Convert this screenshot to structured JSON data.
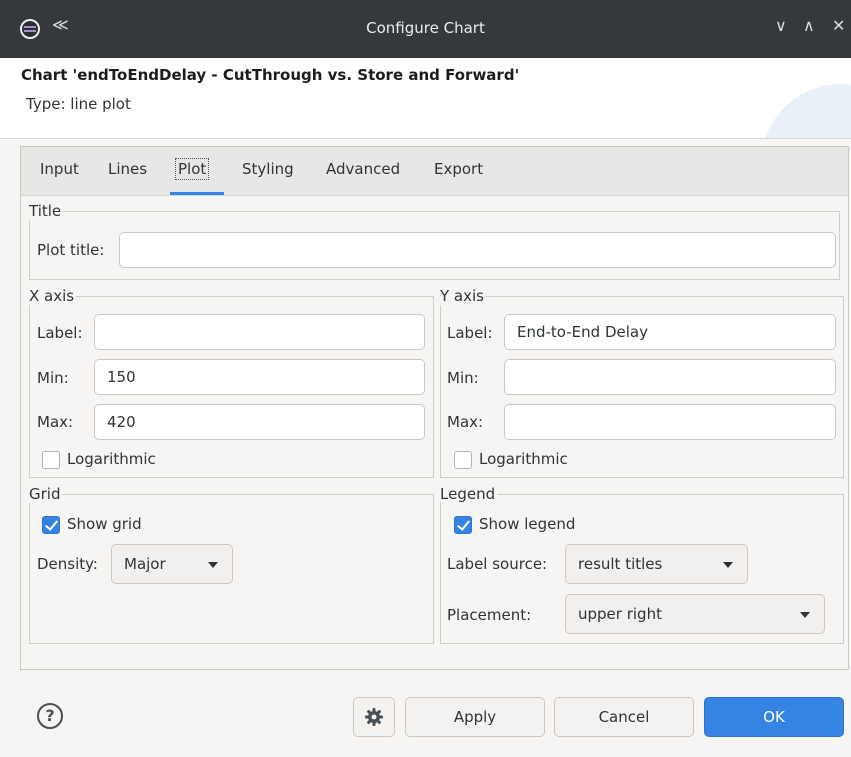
{
  "window": {
    "title": "Configure Chart",
    "pin_glyph": "≪",
    "controls": {
      "minimize": "∨",
      "maximize": "∧",
      "close": "✕"
    }
  },
  "header": {
    "chart_title": "Chart 'endToEndDelay - CutThrough vs. Store and Forward'",
    "chart_type": "Type: line plot"
  },
  "tabs": [
    "Input",
    "Lines",
    "Plot",
    "Styling",
    "Advanced",
    "Export"
  ],
  "active_tab": "Plot",
  "title_group": {
    "label": "Title",
    "plot_title_label": "Plot title:",
    "plot_title_value": ""
  },
  "x_axis": {
    "label": "X axis",
    "label_field_label": "Label:",
    "label_value": "",
    "min_label": "Min:",
    "min_value": "150",
    "max_label": "Max:",
    "max_value": "420",
    "log_label": "Logarithmic",
    "log_checked": false
  },
  "y_axis": {
    "label": "Y axis",
    "label_field_label": "Label:",
    "label_value": "End-to-End Delay",
    "min_label": "Min:",
    "min_value": "",
    "max_label": "Max:",
    "max_value": "",
    "log_label": "Logarithmic",
    "log_checked": false
  },
  "grid": {
    "label": "Grid",
    "show_label": "Show grid",
    "show_checked": true,
    "density_label": "Density:",
    "density_value": "Major"
  },
  "legend": {
    "label": "Legend",
    "show_label": "Show legend",
    "show_checked": true,
    "label_source_label": "Label source:",
    "label_source_value": "result titles",
    "placement_label": "Placement:",
    "placement_value": "upper right"
  },
  "footer": {
    "help_glyph": "?",
    "settings_icon": "gear-icon",
    "apply": "Apply",
    "cancel": "Cancel",
    "ok": "OK"
  },
  "colors": {
    "accent": "#3584e4",
    "titlebar": "#35393d"
  }
}
